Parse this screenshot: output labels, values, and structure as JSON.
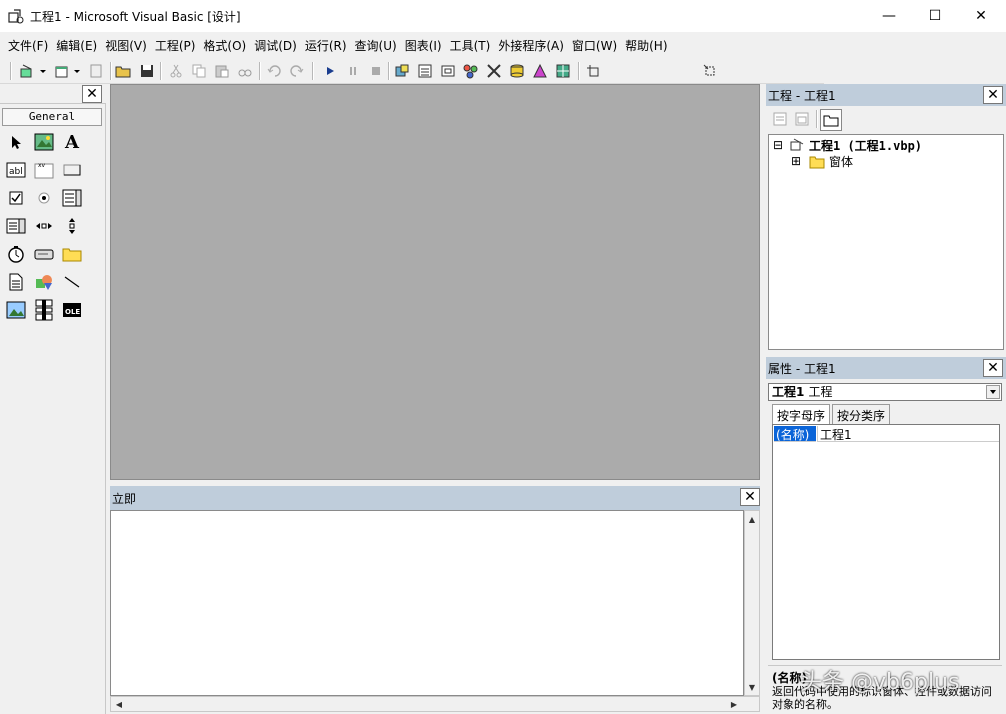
{
  "window": {
    "title": "工程1 - Microsoft Visual Basic [设计]",
    "minimize": "—",
    "maximize": "☐",
    "close": "✕"
  },
  "menu": [
    "文件(F)",
    "编辑(E)",
    "视图(V)",
    "工程(P)",
    "格式(O)",
    "调试(D)",
    "运行(R)",
    "查询(U)",
    "图表(I)",
    "工具(T)",
    "外接程序(A)",
    "窗口(W)",
    "帮助(H)"
  ],
  "toolbox": {
    "close": "✕",
    "tab": "General"
  },
  "immediate": {
    "title": "立即",
    "close": "✕"
  },
  "project": {
    "title": "工程 - 工程1",
    "close": "✕",
    "root": "工程1 (工程1.vbp)",
    "folder": "窗体",
    "expand_root": "⊟",
    "expand_folder": "⊞"
  },
  "properties": {
    "title": "属性 - 工程1",
    "close": "✕",
    "object_bold": "工程1",
    "object_type": "工程",
    "tab_alpha": "按字母序",
    "tab_category": "按分类序",
    "row_name": "(名称)",
    "row_value": "工程1",
    "desc_title": "(名称)",
    "desc_text": "返回代码中使用的标识窗体、控件或数据访问对象的名称。"
  },
  "watermark": "头条 @vb6plus",
  "colors": {
    "panel_header": "#bfcddb",
    "designer_bg": "#ababab",
    "selected": "#0a64d8"
  }
}
